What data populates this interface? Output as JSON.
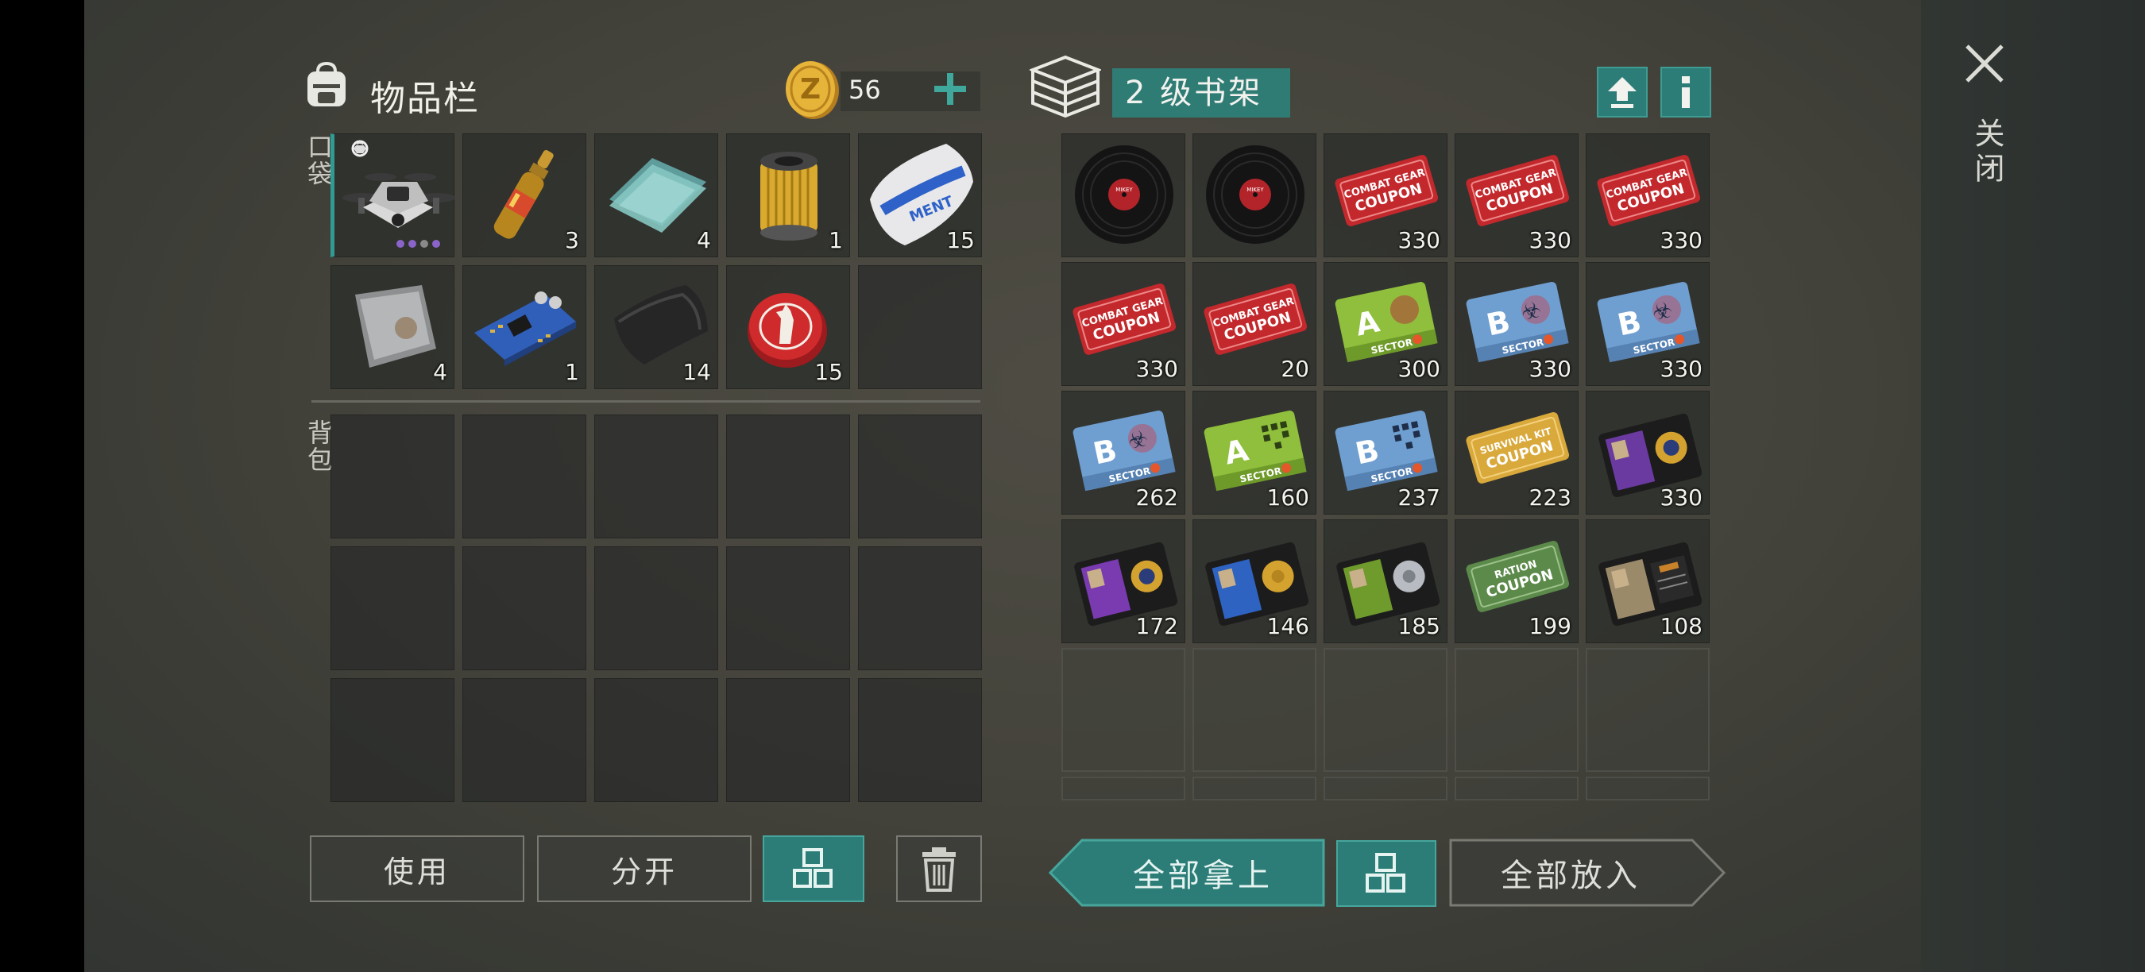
{
  "inventory": {
    "title": "物品栏",
    "coins": "56",
    "pocket_label": "口袋",
    "backpack_label": "背包",
    "pocket_items": [
      {
        "icon": "drone-icon",
        "count": ""
      },
      {
        "icon": "ampoule-icon",
        "count": "3"
      },
      {
        "icon": "glass-sheets-icon",
        "count": "4"
      },
      {
        "icon": "filter-icon",
        "count": "1"
      },
      {
        "icon": "cement-bag-icon",
        "count": "15"
      },
      {
        "icon": "metal-plate-icon",
        "count": "4"
      },
      {
        "icon": "circuit-board-icon",
        "count": "1"
      },
      {
        "icon": "cloth-icon",
        "count": "14"
      },
      {
        "icon": "bottle-cap-icon",
        "count": "15"
      },
      {
        "icon": "",
        "count": ""
      }
    ],
    "buttons": {
      "use": "使用",
      "split": "分开"
    }
  },
  "shelf": {
    "name": "2 级书架",
    "items": [
      {
        "icon": "vinyl-record-icon",
        "count": ""
      },
      {
        "icon": "vinyl-record-icon",
        "count": ""
      },
      {
        "icon": "combat-gear-coupon-icon",
        "count": "330"
      },
      {
        "icon": "combat-gear-coupon-icon",
        "count": "330"
      },
      {
        "icon": "combat-gear-coupon-icon",
        "count": "330"
      },
      {
        "icon": "combat-gear-coupon-icon",
        "count": "330"
      },
      {
        "icon": "combat-gear-coupon-icon",
        "count": "20"
      },
      {
        "icon": "sector-a-card-icon",
        "count": "300"
      },
      {
        "icon": "sector-b-card-icon",
        "count": "330"
      },
      {
        "icon": "sector-b-card-icon",
        "count": "330"
      },
      {
        "icon": "sector-b-card-icon",
        "count": "262"
      },
      {
        "icon": "sector-a-qr-card-icon",
        "count": "160"
      },
      {
        "icon": "sector-b-qr-card-icon",
        "count": "237"
      },
      {
        "icon": "survival-kit-coupon-icon",
        "count": "223"
      },
      {
        "icon": "police-badge-wallet-icon",
        "count": "330"
      },
      {
        "icon": "purple-badge-wallet-icon",
        "count": "172"
      },
      {
        "icon": "blue-badge-wallet-icon",
        "count": "146"
      },
      {
        "icon": "green-badge-wallet-icon",
        "count": "185"
      },
      {
        "icon": "ration-coupon-icon",
        "count": "199"
      },
      {
        "icon": "patrol-badge-wallet-icon",
        "count": "108"
      }
    ],
    "buttons": {
      "take_all": "全部拿上",
      "put_all": "全部放入"
    }
  },
  "close_label": "关闭",
  "colors": {
    "accent": "#2c7d77",
    "coupon_red": "#c2282c",
    "card_blue": "#6f9fd0",
    "card_green": "#8fbf3c",
    "gold": "#d9a93b"
  },
  "coupon_text": {
    "combat": "COMBAT GEAR COUPON",
    "survival": "SURVIVAL KIT COUPON",
    "ration": "RATION COUPON",
    "sector": "SECTOR",
    "a": "A",
    "b": "B",
    "vinyl": "MIKEY",
    "cement": "MENT"
  }
}
